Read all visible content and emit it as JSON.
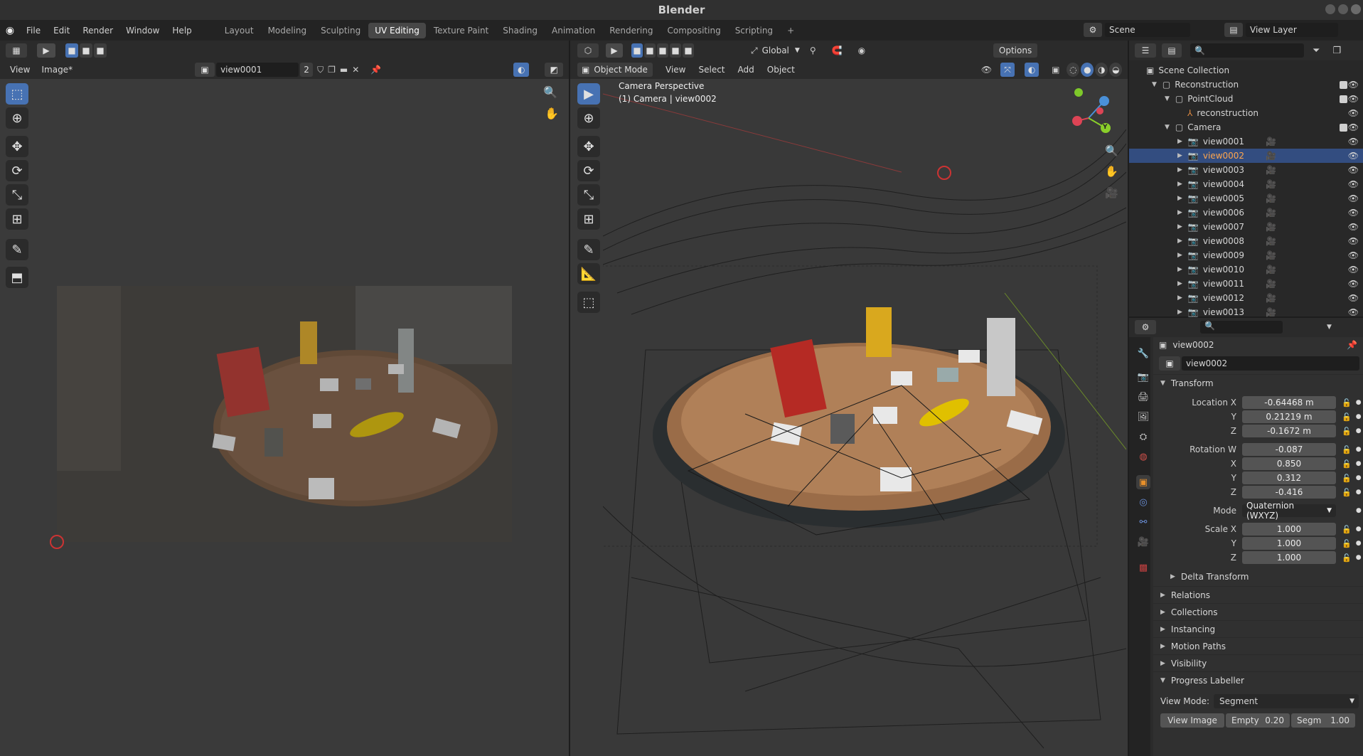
{
  "window": {
    "title": "Blender"
  },
  "menu": [
    "File",
    "Edit",
    "Render",
    "Window",
    "Help"
  ],
  "workspaces": [
    "Layout",
    "Modeling",
    "Sculpting",
    "UV Editing",
    "Texture Paint",
    "Shading",
    "Animation",
    "Rendering",
    "Compositing",
    "Scripting",
    "+"
  ],
  "active_workspace": "UV Editing",
  "scene": {
    "label": "Scene",
    "view_layer": "View Layer"
  },
  "uv_editor": {
    "view_menu": "View",
    "image_menu": "Image*",
    "image_name": "view0001",
    "users": "2"
  },
  "viewport": {
    "orientation": "Global",
    "options": "Options",
    "mode": "Object Mode",
    "menus": [
      "View",
      "Select",
      "Add",
      "Object"
    ],
    "overlay_line1": "Camera Perspective",
    "overlay_line2": "(1) Camera | view0002",
    "gizmo_y": "Y"
  },
  "outliner": {
    "root": "Scene Collection",
    "reconstruction": "Reconstruction",
    "pointcloud": "PointCloud",
    "recon_obj": "reconstruction",
    "camera": "Camera",
    "views": [
      "view0001",
      "view0002",
      "view0003",
      "view0004",
      "view0005",
      "view0006",
      "view0007",
      "view0008",
      "view0009",
      "view0010",
      "view0011",
      "view0012",
      "view0013"
    ],
    "selected": "view0002"
  },
  "properties": {
    "object_name": "view0002",
    "data_name": "view0002",
    "transform": "Transform",
    "location": {
      "label": "Location X",
      "x": "-0.64468 m",
      "y": "0.21219 m",
      "z": "-0.1672 m"
    },
    "rotation": {
      "label": "Rotation W",
      "w": "-0.087",
      "x": "0.850",
      "y": "0.312",
      "z": "-0.416"
    },
    "mode_label": "Mode",
    "mode": "Quaternion (WXYZ)",
    "scale": {
      "label": "Scale X",
      "x": "1.000",
      "y": "1.000",
      "z": "1.000"
    },
    "axis_y": "Y",
    "axis_z": "Z",
    "axis_x": "X",
    "delta": "Delta Transform",
    "panels": [
      "Relations",
      "Collections",
      "Instancing",
      "Motion Paths",
      "Visibility"
    ],
    "progress_panel": "Progress Labeller",
    "view_mode_label": "View Mode:",
    "view_mode": "Segment",
    "view_image_btn": "View Image",
    "empty_label": "Empty",
    "empty_value": "0.20",
    "segm_label": "Segm",
    "segm_value": "1.00"
  },
  "colors": {
    "accent": "#4772b3",
    "selected_row": "#334d80",
    "camera_icon": "#e08a40"
  }
}
